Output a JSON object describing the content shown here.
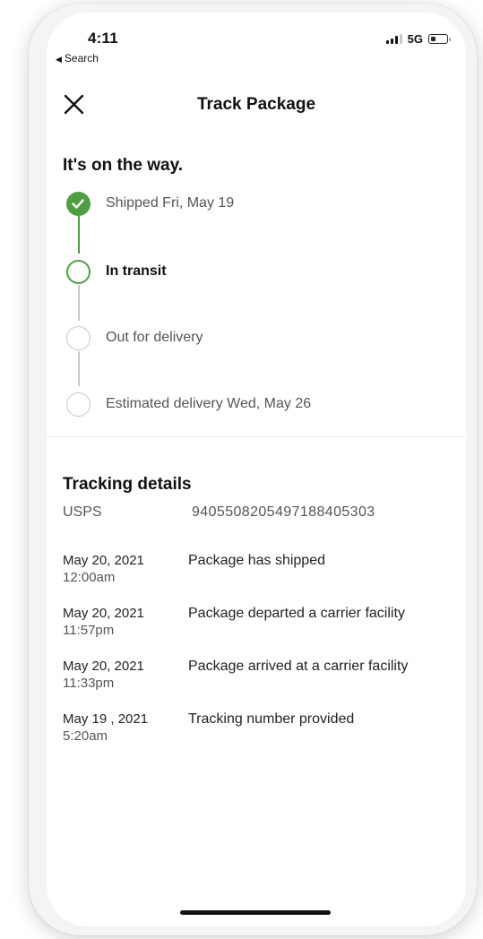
{
  "status_bar": {
    "time": "4:11",
    "back_label": "Search",
    "network": "5G"
  },
  "nav": {
    "title": "Track Package",
    "close_icon": "close-icon"
  },
  "shipment_status": {
    "heading": "It's on the way.",
    "accent_color": "#4f9e44",
    "steps": [
      {
        "label": "Shipped Fri, May 19",
        "state": "done"
      },
      {
        "label": "In transit",
        "state": "current"
      },
      {
        "label": "Out for delivery",
        "state": "pending"
      },
      {
        "label": "Estimated delivery Wed, May 26",
        "state": "pending"
      }
    ]
  },
  "tracking": {
    "heading": "Tracking details",
    "carrier": "USPS",
    "number": "9405508205497188405303",
    "events": [
      {
        "date": "May 20, 2021",
        "time": "12:00am",
        "description": "Package has shipped"
      },
      {
        "date": "May 20, 2021",
        "time": "11:57pm",
        "description": "Package departed a carrier facility"
      },
      {
        "date": "May 20, 2021",
        "time": "11:33pm",
        "description": "Package arrived at a carrier facility"
      },
      {
        "date": "May 19 , 2021",
        "time": "5:20am",
        "description": "Tracking number provided"
      }
    ]
  }
}
